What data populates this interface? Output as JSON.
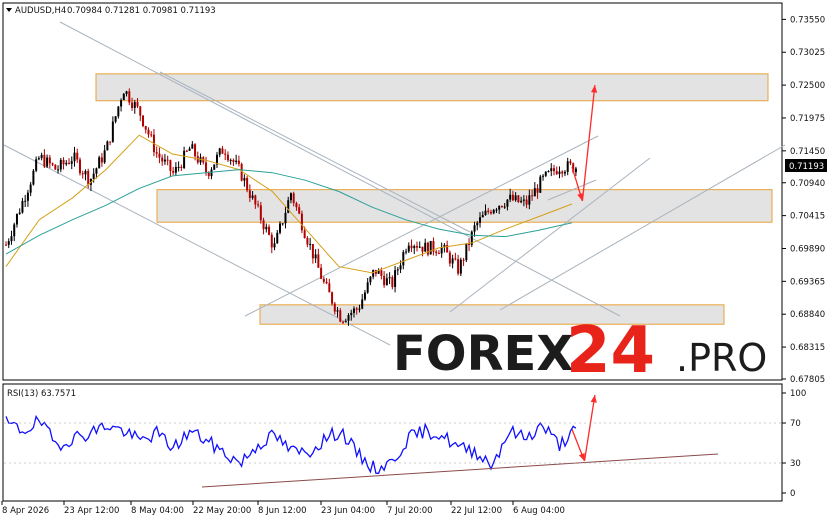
{
  "header": {
    "symbol": "AUDUSD,H4",
    "ohlc": "0.70984 0.71281 0.70981 0.71193"
  },
  "rsi_panel": {
    "label": "RSI(13) 63.7571",
    "levels": [
      "100",
      "70",
      "30",
      "0"
    ]
  },
  "watermark": {
    "part1": "FOREX",
    "part2": "24",
    "part3": ".PRO"
  },
  "colors": {
    "bull_candle": "#000000",
    "bear_candle": "#b00000",
    "ma_fast": "#d4a017",
    "ma_slow": "#2aa198",
    "rsi_line": "#1010ff",
    "zone_fill": "#e3e3e3",
    "zone_border": "#e8a23a",
    "forecast_arrow": "#ff2a2a",
    "channel_line": "#a9b4bf",
    "rsi_trendline": "#8b4a4a",
    "price_tag_bg": "#000000",
    "price_tag_text": "#ffffff"
  },
  "chart_data": {
    "type": "line",
    "symbol": "AUDUSD",
    "timeframe": "H4",
    "x_tick_labels": [
      "8 Apr 2026",
      "23 Apr 12:00",
      "8 May 04:00",
      "22 May 20:00",
      "8 Jun 12:00",
      "23 Jun 04:00",
      "7 Jul 20:00",
      "22 Jul 12:00",
      "6 Aug 04:00"
    ],
    "y_tick_labels": [
      "0.73550",
      "0.73025",
      "0.72500",
      "0.71975",
      "0.71450",
      "0.70940",
      "0.70415",
      "0.69890",
      "0.69365",
      "0.68840",
      "0.68315",
      "0.67805"
    ],
    "ylim": [
      0.67805,
      0.7362
    ],
    "current_price_label": "0.71193",
    "last_ohlc": {
      "open": 0.70984,
      "high": 0.71281,
      "low": 0.70981,
      "close": 0.71193
    },
    "series": [
      {
        "name": "AUDUSD,H4",
        "kind": "price",
        "x": [
          0,
          8,
          16,
          24,
          32,
          40,
          48,
          56,
          64,
          72,
          80,
          88,
          96,
          104,
          112,
          120,
          128,
          136,
          144,
          152,
          160,
          168,
          176,
          184,
          192,
          200,
          208,
          216,
          224,
          232,
          240,
          248,
          256,
          264,
          272
        ],
        "values": [
          0.6995,
          0.7065,
          0.7135,
          0.7115,
          0.7135,
          0.7098,
          0.7148,
          0.7245,
          0.7205,
          0.714,
          0.7108,
          0.715,
          0.711,
          0.715,
          0.711,
          0.705,
          0.699,
          0.7078,
          0.7003,
          0.693,
          0.6878,
          0.6893,
          0.6955,
          0.693,
          0.7003,
          0.699,
          0.699,
          0.6955,
          0.7025,
          0.7055,
          0.7068,
          0.706,
          0.7098,
          0.712,
          0.7119
        ]
      },
      {
        "name": "",
        "kind": "ma-fast",
        "x": [
          0,
          16,
          32,
          48,
          64,
          80,
          96,
          112,
          128,
          144,
          160,
          176,
          192,
          208,
          224,
          240,
          256,
          272
        ],
        "values": [
          0.696,
          0.7035,
          0.707,
          0.7115,
          0.717,
          0.714,
          0.713,
          0.7115,
          0.708,
          0.702,
          0.696,
          0.695,
          0.697,
          0.699,
          0.6998,
          0.702,
          0.704,
          0.706
        ]
      },
      {
        "name": "",
        "kind": "ma-slow",
        "x": [
          0,
          16,
          32,
          48,
          64,
          80,
          96,
          112,
          128,
          144,
          160,
          176,
          192,
          208,
          224,
          240,
          256,
          272
        ],
        "values": [
          0.698,
          0.701,
          0.7035,
          0.7058,
          0.7085,
          0.7105,
          0.711,
          0.7115,
          0.711,
          0.7098,
          0.708,
          0.7055,
          0.7035,
          0.702,
          0.701,
          0.7008,
          0.7018,
          0.703
        ]
      },
      {
        "name": "RSI(13)",
        "kind": "rsi",
        "x": [
          0,
          8,
          16,
          24,
          32,
          40,
          48,
          56,
          64,
          72,
          80,
          88,
          96,
          104,
          112,
          120,
          128,
          136,
          144,
          152,
          160,
          168,
          176,
          184,
          192,
          200,
          208,
          216,
          224,
          232,
          240,
          248,
          256,
          264,
          272
        ],
        "values": [
          70,
          62,
          72,
          48,
          55,
          60,
          68,
          62,
          52,
          60,
          45,
          62,
          52,
          40,
          30,
          48,
          58,
          42,
          40,
          54,
          62,
          38,
          24,
          30,
          55,
          62,
          58,
          45,
          42,
          28,
          62,
          55,
          68,
          48,
          63.76
        ]
      }
    ],
    "zones": [
      {
        "from": 0.7225,
        "to": 0.7268
      },
      {
        "from": 0.7031,
        "to": 0.7083
      },
      {
        "from": 0.6868,
        "to": 0.6899
      }
    ],
    "forecast_path": [
      {
        "x": 272,
        "value": 0.71193
      },
      {
        "x": 277,
        "value": 0.7065
      },
      {
        "x": 283,
        "value": 0.725
      }
    ],
    "rsi_forecast_path": [
      {
        "x": 272,
        "value": 63.76
      },
      {
        "x": 278,
        "value": 32
      },
      {
        "x": 283,
        "value": 98
      }
    ]
  }
}
